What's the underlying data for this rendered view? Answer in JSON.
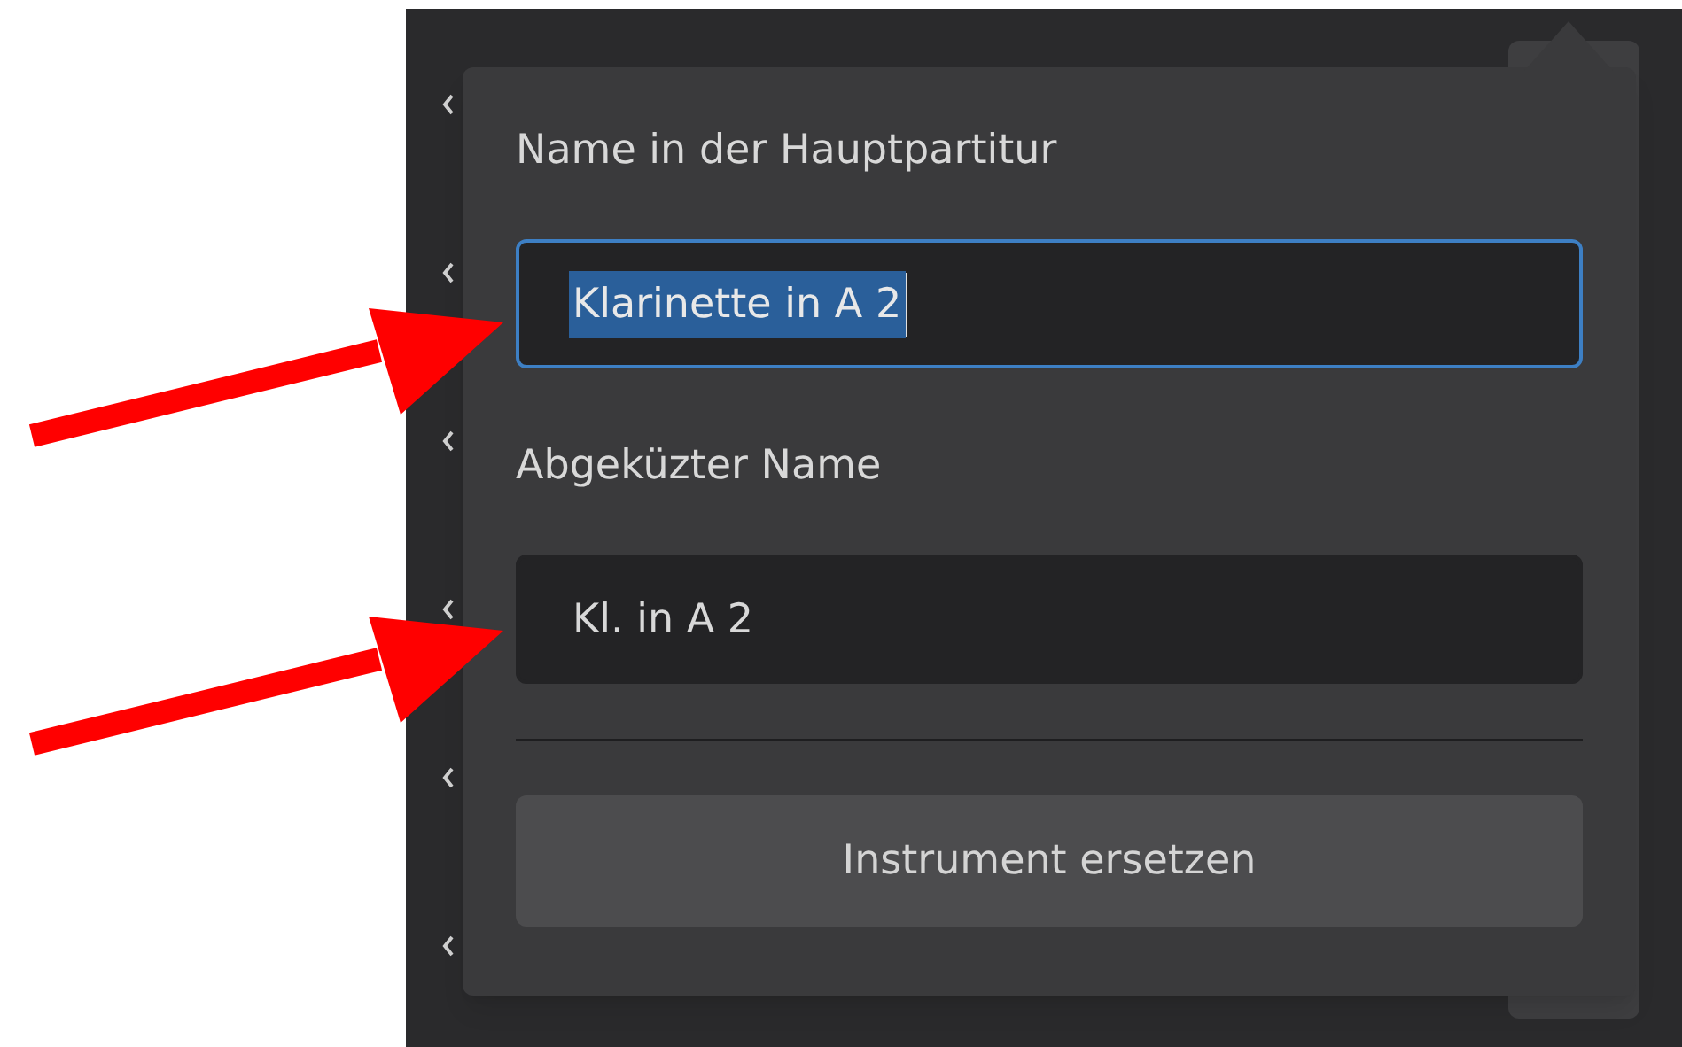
{
  "popup": {
    "fields": [
      {
        "label": "Name in der Hauptpartitur",
        "value": "Klarinette in A 2",
        "focused": true,
        "text_selected": true
      },
      {
        "label": "Abgeküzter Name",
        "value": "Kl. in A 2",
        "focused": false,
        "text_selected": false
      }
    ],
    "button": "Instrument ersetzen"
  }
}
